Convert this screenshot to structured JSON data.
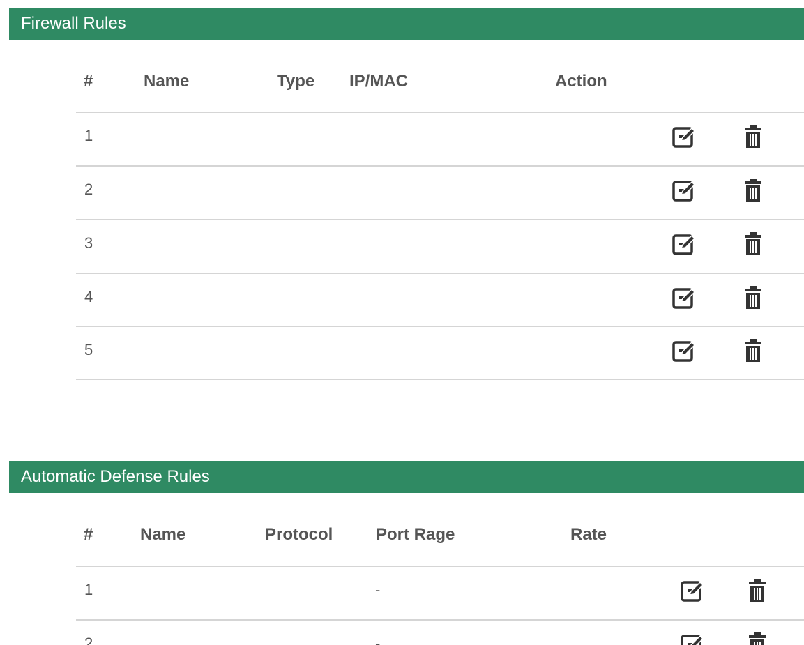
{
  "firewall": {
    "title": "Firewall Rules",
    "columns": [
      "#",
      "Name",
      "Type",
      "IP/MAC",
      "Action"
    ],
    "rows": [
      {
        "num": "1"
      },
      {
        "num": "2"
      },
      {
        "num": "3"
      },
      {
        "num": "4"
      },
      {
        "num": "5"
      }
    ]
  },
  "defense": {
    "title": "Automatic Defense Rules",
    "columns": [
      "#",
      "Name",
      "Protocol",
      "Port Rage",
      "Rate"
    ],
    "rows": [
      {
        "num": "1",
        "port_range": "-"
      },
      {
        "num": "2",
        "port_range": "-"
      }
    ]
  },
  "icons": {
    "edit": "edit-icon",
    "delete": "trash-icon"
  },
  "colors": {
    "header_bg": "#2f8a63",
    "text": "#555555",
    "divider": "#d5d5d5",
    "icon": "#333333"
  }
}
